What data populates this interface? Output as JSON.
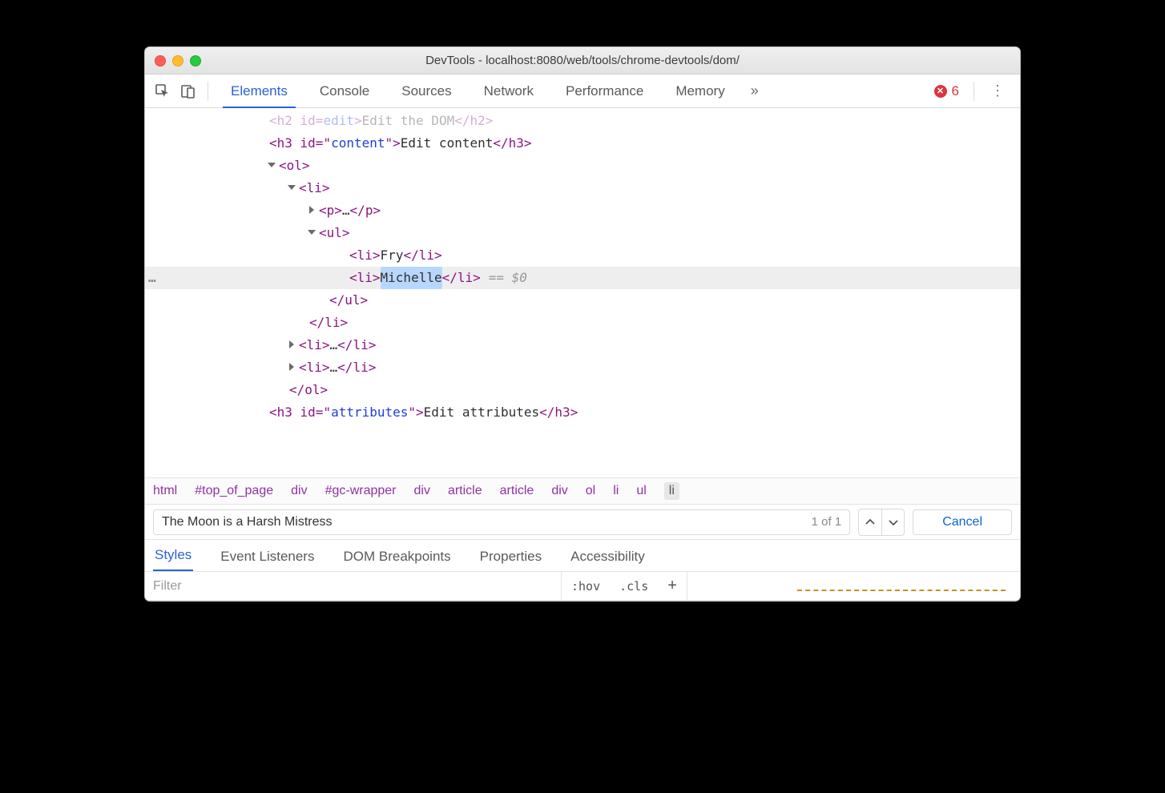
{
  "window": {
    "title": "DevTools - localhost:8080/web/tools/chrome-devtools/dom/"
  },
  "toolbar": {
    "tabs": {
      "elements": "Elements",
      "console": "Console",
      "sources": "Sources",
      "network": "Network",
      "performance": "Performance",
      "memory": "Memory"
    },
    "more_glyph": "»",
    "error_count": "6",
    "error_x": "✕"
  },
  "dom": {
    "row0": {
      "open": "<h2 id=",
      "attr": "edit",
      "mid": ">",
      "text": "Edit the DOM",
      "close": "</h2>"
    },
    "row1": {
      "open": "<h3 id=\"",
      "attr": "content",
      "mid": "\">",
      "text": "Edit content",
      "close": "</h3>"
    },
    "row2": "<ol>",
    "row3": "<li>",
    "row4": {
      "open": "<p>",
      "ell": "…",
      "close": "</p>"
    },
    "row5": "<ul>",
    "row6": {
      "open": "<li>",
      "text": "Fry",
      "close": "</li>"
    },
    "row7": {
      "open": "<li>",
      "text": "Michelle",
      "close": "</li>",
      "sel0": "== $0"
    },
    "row8": "</ul>",
    "row9": "</li>",
    "row10": {
      "open": "<li>",
      "ell": "…",
      "close": "</li>"
    },
    "row11": {
      "open": "<li>",
      "ell": "…",
      "close": "</li>"
    },
    "row12": "</ol>",
    "row13": {
      "open": "<h3 id=\"",
      "attr": "attributes",
      "mid": "\">",
      "text": "Edit attributes",
      "close": "</h3>"
    },
    "ellipsis": "…"
  },
  "breadcrumb": {
    "c0": "html",
    "c1": "#top_of_page",
    "c2": "div",
    "c3": "#gc-wrapper",
    "c4": "div",
    "c5": "article",
    "c6": "article",
    "c7": "div",
    "c8": "ol",
    "c9": "li",
    "c10": "ul",
    "c11": "li"
  },
  "search": {
    "value": "The Moon is a Harsh Mistress",
    "count": "1 of 1",
    "cancel": "Cancel"
  },
  "styles_tabs": {
    "styles": "Styles",
    "listeners": "Event Listeners",
    "dom_bp": "DOM Breakpoints",
    "props": "Properties",
    "a11y": "Accessibility"
  },
  "filter": {
    "placeholder": "Filter",
    "hov": ":hov",
    "cls": ".cls",
    "plus": "+"
  }
}
